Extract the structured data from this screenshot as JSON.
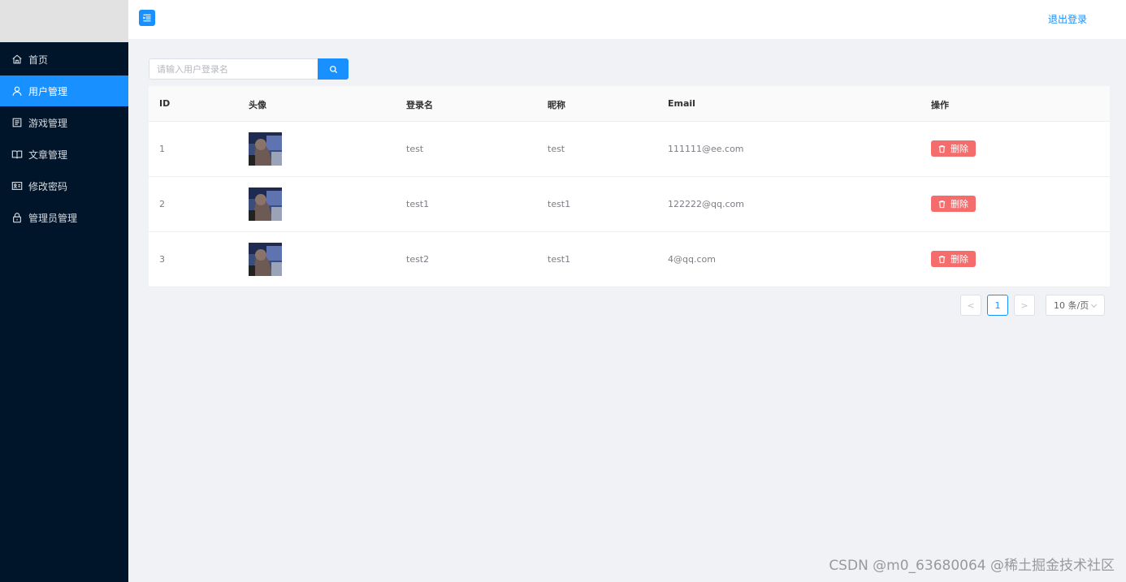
{
  "header": {
    "logout_label": "退出登录"
  },
  "sidebar": {
    "items": [
      {
        "label": "首页",
        "icon": "home-icon",
        "active": false
      },
      {
        "label": "用户管理",
        "icon": "user-icon",
        "active": true
      },
      {
        "label": "游戏管理",
        "icon": "document-icon",
        "active": false
      },
      {
        "label": "文章管理",
        "icon": "book-icon",
        "active": false
      },
      {
        "label": "修改密码",
        "icon": "id-card-icon",
        "active": false
      },
      {
        "label": "管理员管理",
        "icon": "lock-icon",
        "active": false
      }
    ]
  },
  "search": {
    "placeholder": "请输入用户登录名",
    "value": ""
  },
  "table": {
    "columns": [
      "ID",
      "头像",
      "登录名",
      "昵称",
      "Email",
      "操作"
    ],
    "rows": [
      {
        "id": "1",
        "login": "test",
        "nickname": "test",
        "email": "111111@ee.com",
        "action": "删除"
      },
      {
        "id": "2",
        "login": "test1",
        "nickname": "test1",
        "email": "122222@qq.com",
        "action": "删除"
      },
      {
        "id": "3",
        "login": "test2",
        "nickname": "test1",
        "email": "4@qq.com",
        "action": "删除"
      }
    ]
  },
  "pagination": {
    "prev": "<",
    "current_page": "1",
    "next": ">",
    "page_size": "10 条/页"
  },
  "watermark": "CSDN @m0_63680064  @稀土掘金技术社区",
  "colors": {
    "primary": "#1890ff",
    "danger": "#f56c6c",
    "sidebar_bg": "#001529"
  }
}
